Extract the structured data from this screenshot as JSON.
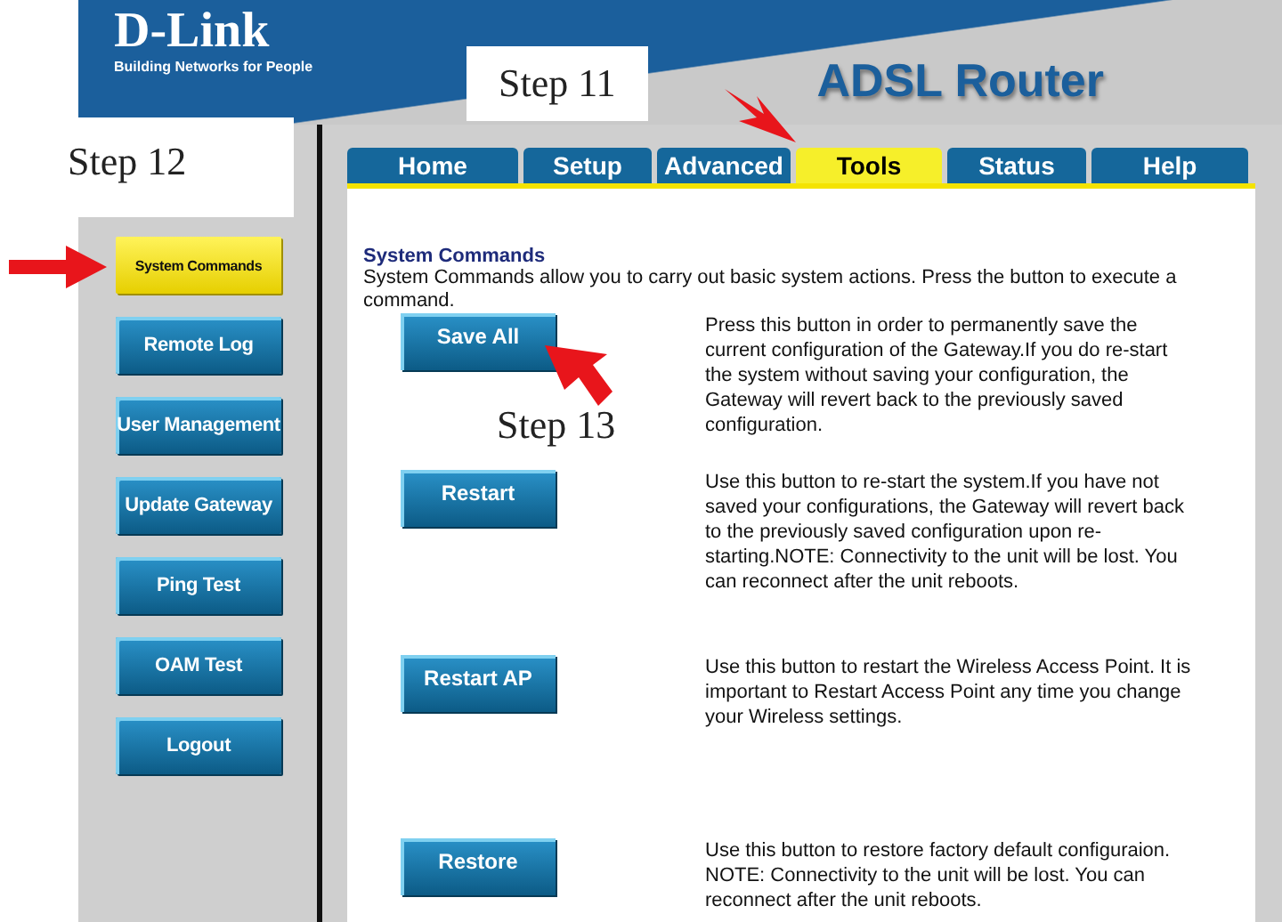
{
  "header": {
    "logo": "D-Link",
    "tagline": "Building Networks for People",
    "product": "ADSL Router"
  },
  "tabs": [
    {
      "label": "Home",
      "selected": false
    },
    {
      "label": "Setup",
      "selected": false
    },
    {
      "label": "Advanced",
      "selected": false
    },
    {
      "label": "Tools",
      "selected": true
    },
    {
      "label": "Status",
      "selected": false
    },
    {
      "label": "Help",
      "selected": false
    }
  ],
  "sidebar": {
    "items": [
      {
        "label": "System Commands",
        "selected": true
      },
      {
        "label": "Remote Log",
        "selected": false
      },
      {
        "label": "User Management",
        "selected": false
      },
      {
        "label": "Update Gateway",
        "selected": false
      },
      {
        "label": "Ping Test",
        "selected": false
      },
      {
        "label": "OAM Test",
        "selected": false
      },
      {
        "label": "Logout",
        "selected": false
      }
    ]
  },
  "content": {
    "title": "System Commands",
    "intro": "System Commands allow you to carry out basic system actions. Press the button to execute a command.",
    "commands": [
      {
        "button": "Save All",
        "description": "Press this button in order to permanently save the current configuration of the Gateway.If you do re-start the system without saving your configuration, the Gateway will revert back to the previously saved configuration."
      },
      {
        "button": "Restart",
        "description": "Use this button to re-start the system.If you have not saved your configurations, the Gateway will revert back to the previously saved configuration upon re-starting.NOTE: Connectivity to the unit will be lost. You can reconnect after the unit reboots."
      },
      {
        "button": "Restart AP",
        "description": "Use this button to restart the Wireless Access Point. It is important to Restart Access Point any time you change your Wireless settings."
      },
      {
        "button": "Restore",
        "description": "Use this button to restore factory default configuraion. NOTE: Connectivity to the unit will be lost. You can reconnect after the unit reboots."
      }
    ]
  },
  "annotations": [
    {
      "text": "Step 11"
    },
    {
      "text": "Step 12"
    },
    {
      "text": "Step 13"
    }
  ]
}
